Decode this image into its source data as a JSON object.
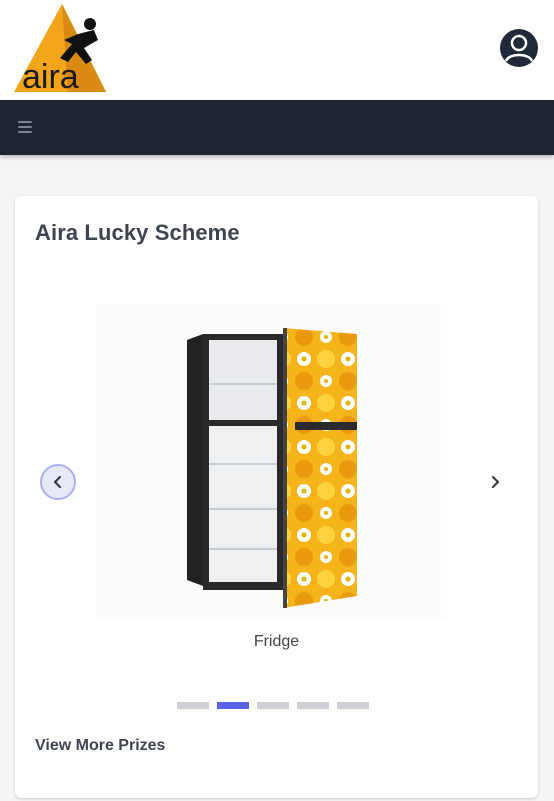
{
  "header": {
    "logo_text": "aira",
    "logo_icon": "aira-logo-icon",
    "avatar_icon": "user-avatar-icon"
  },
  "navbar": {
    "menu_icon": "hamburger-menu-icon"
  },
  "card": {
    "title": "Aira Lucky Scheme",
    "carousel": {
      "current_caption": "Fridge",
      "prev_icon": "chevron-left-icon",
      "next_icon": "chevron-right-icon",
      "slide_count": 5,
      "active_index": 1
    },
    "view_more_label": "View More Prizes"
  },
  "colors": {
    "navbar_bg": "#1e2433",
    "indicator_active": "#5b63e8",
    "indicator_inactive": "#cfd1d6",
    "logo_orange": "#f2a51a"
  }
}
